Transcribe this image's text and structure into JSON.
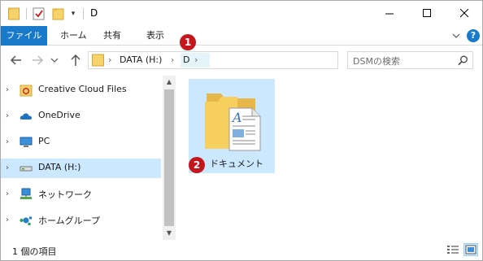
{
  "window": {
    "title": "D"
  },
  "ribbon": {
    "tabs": [
      {
        "label": "ファイル"
      },
      {
        "label": "ホーム"
      },
      {
        "label": "共有"
      },
      {
        "label": "表示"
      }
    ],
    "help": "?"
  },
  "address": {
    "segments": [
      "DATA (H:)",
      "D"
    ]
  },
  "search": {
    "placeholder": "DSMの検索"
  },
  "nav": {
    "items": [
      {
        "label": "Creative Cloud Files",
        "icon": "creative-cloud-icon"
      },
      {
        "label": "OneDrive",
        "icon": "onedrive-cloud-icon"
      },
      {
        "label": "PC",
        "icon": "pc-monitor-icon"
      },
      {
        "label": "DATA (H:)",
        "icon": "drive-icon",
        "selected": true
      },
      {
        "label": "ネットワーク",
        "icon": "network-icon"
      },
      {
        "label": "ホームグループ",
        "icon": "homegroup-icon"
      }
    ]
  },
  "content": {
    "items": [
      {
        "name": "ドキュメント",
        "icon": "folder-document-icon",
        "selected": true
      }
    ]
  },
  "annotations": {
    "badge1": "1",
    "badge2": "2",
    "color": "#c4161c"
  },
  "status": {
    "text": "1 個の項目"
  },
  "colors": {
    "accent": "#1979ca",
    "selection": "#cce8ff",
    "folder": "#f6cf5e"
  }
}
